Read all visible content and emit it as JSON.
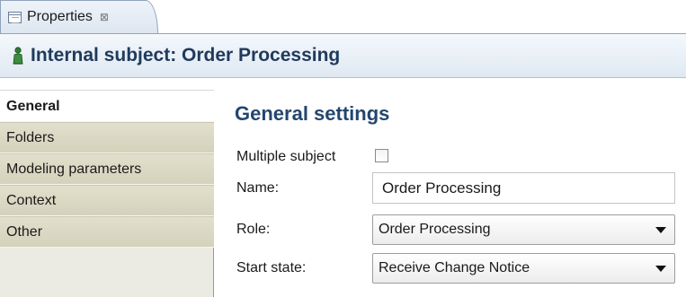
{
  "tab": {
    "label": "Properties",
    "close": "⊠",
    "icon": "properties-view-icon"
  },
  "header": {
    "title": "Internal subject: Order Processing",
    "icon": "subject-person-icon"
  },
  "nav": {
    "items": [
      {
        "label": "General",
        "active": true
      },
      {
        "label": "Folders",
        "active": false
      },
      {
        "label": "Modeling parameters",
        "active": false
      },
      {
        "label": "Context",
        "active": false
      },
      {
        "label": "Other",
        "active": false
      }
    ]
  },
  "form": {
    "section_title": "General settings",
    "multiple_subject_label": "Multiple subject",
    "multiple_subject_checked": false,
    "name_label": "Name:",
    "name_value": "Order Processing",
    "role_label": "Role:",
    "role_value": "Order Processing",
    "start_state_label": "Start state:",
    "start_state_value": "Receive Change Notice"
  },
  "colors": {
    "header_title": "#1f3a5c",
    "section_title": "#24466e",
    "nav_bg": "#d4d2bb",
    "subject_icon": "#2e7d32"
  }
}
